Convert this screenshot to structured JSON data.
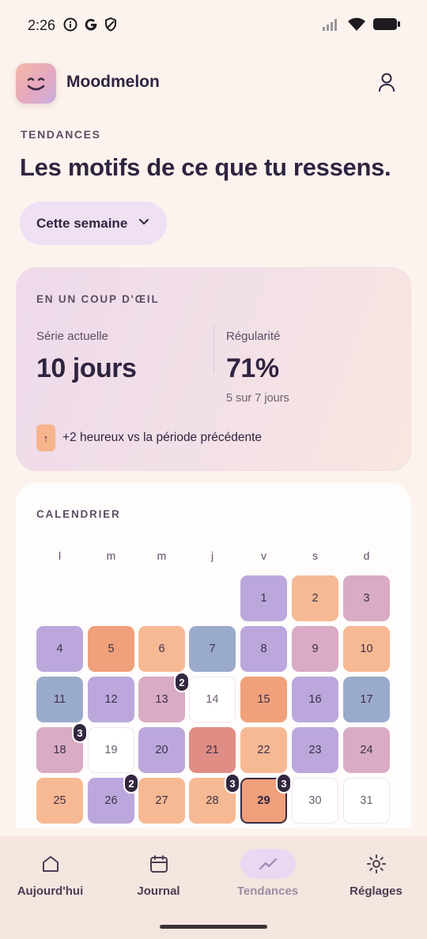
{
  "status_bar": {
    "time": "2:26",
    "icons": [
      "info-icon",
      "google-icon",
      "shield-icon",
      "signal-icon",
      "wifi-icon",
      "battery-icon"
    ]
  },
  "header": {
    "app_name": "Moodmelon",
    "icons": [
      "logo-smile-icon",
      "profile-icon"
    ]
  },
  "trends": {
    "kicker": "TENDANCES",
    "title": "Les motifs de ce que tu ressens.",
    "period_select": {
      "label": "Cette semaine"
    }
  },
  "glance": {
    "kicker": "EN UN COUP D'ŒIL",
    "streak_label": "Série actuelle",
    "streak_value": "10 jours",
    "regularity_label": "Régularité",
    "regularity_value": "71%",
    "regularity_sub": "5 sur 7 jours",
    "trend_arrow": "↑",
    "trend_text": "+2 heureux vs la période précédente"
  },
  "calendar": {
    "kicker": "CALENDRIER",
    "weekdays": [
      "l",
      "m",
      "m",
      "j",
      "v",
      "s",
      "d"
    ],
    "days": [
      {
        "d": "1",
        "mood": "purple",
        "count": ""
      },
      {
        "d": "2",
        "mood": "peach",
        "count": ""
      },
      {
        "d": "3",
        "mood": "pink",
        "count": ""
      },
      {
        "d": "4",
        "mood": "purple",
        "count": ""
      },
      {
        "d": "5",
        "mood": "orange",
        "count": ""
      },
      {
        "d": "6",
        "mood": "peach",
        "count": ""
      },
      {
        "d": "7",
        "mood": "blue",
        "count": ""
      },
      {
        "d": "8",
        "mood": "purple",
        "count": ""
      },
      {
        "d": "9",
        "mood": "pink",
        "count": ""
      },
      {
        "d": "10",
        "mood": "peach",
        "count": ""
      },
      {
        "d": "11",
        "mood": "blue",
        "count": ""
      },
      {
        "d": "12",
        "mood": "purple",
        "count": ""
      },
      {
        "d": "13",
        "mood": "pink",
        "count": "2"
      },
      {
        "d": "14",
        "mood": "empty",
        "count": ""
      },
      {
        "d": "15",
        "mood": "orange",
        "count": ""
      },
      {
        "d": "16",
        "mood": "purple",
        "count": ""
      },
      {
        "d": "17",
        "mood": "blue",
        "count": ""
      },
      {
        "d": "18",
        "mood": "pink",
        "count": "3"
      },
      {
        "d": "19",
        "mood": "empty",
        "count": ""
      },
      {
        "d": "20",
        "mood": "purple",
        "count": ""
      },
      {
        "d": "21",
        "mood": "red",
        "count": ""
      },
      {
        "d": "22",
        "mood": "peach",
        "count": ""
      },
      {
        "d": "23",
        "mood": "purple",
        "count": ""
      },
      {
        "d": "24",
        "mood": "pink",
        "count": ""
      },
      {
        "d": "25",
        "mood": "peach",
        "count": ""
      },
      {
        "d": "26",
        "mood": "purple",
        "count": "2"
      },
      {
        "d": "27",
        "mood": "peach",
        "count": ""
      },
      {
        "d": "28",
        "mood": "peach",
        "count": "3"
      },
      {
        "d": "29",
        "mood": "orange",
        "count": "3",
        "today": true
      },
      {
        "d": "30",
        "mood": "empty",
        "count": ""
      },
      {
        "d": "31",
        "mood": "empty",
        "count": ""
      }
    ],
    "first_weekday_index": 4,
    "mood_colors": {
      "purple": "#bba7dc",
      "peach": "#f6b993",
      "pink": "#d9abc4",
      "orange": "#f0a07a",
      "blue": "#9aaacb",
      "red": "#e08d86",
      "empty": "#ffffff"
    }
  },
  "nav": {
    "items": [
      {
        "label": "Aujourd'hui",
        "icon": "home-icon"
      },
      {
        "label": "Journal",
        "icon": "calendar-icon"
      },
      {
        "label": "Tendances",
        "icon": "trend-icon",
        "active": true
      },
      {
        "label": "Réglages",
        "icon": "sun-icon"
      }
    ]
  },
  "colors": {
    "background": "#fcf3ee",
    "text": "#2f2440",
    "accent": "#ecd7f3",
    "badge": "#33263f"
  }
}
